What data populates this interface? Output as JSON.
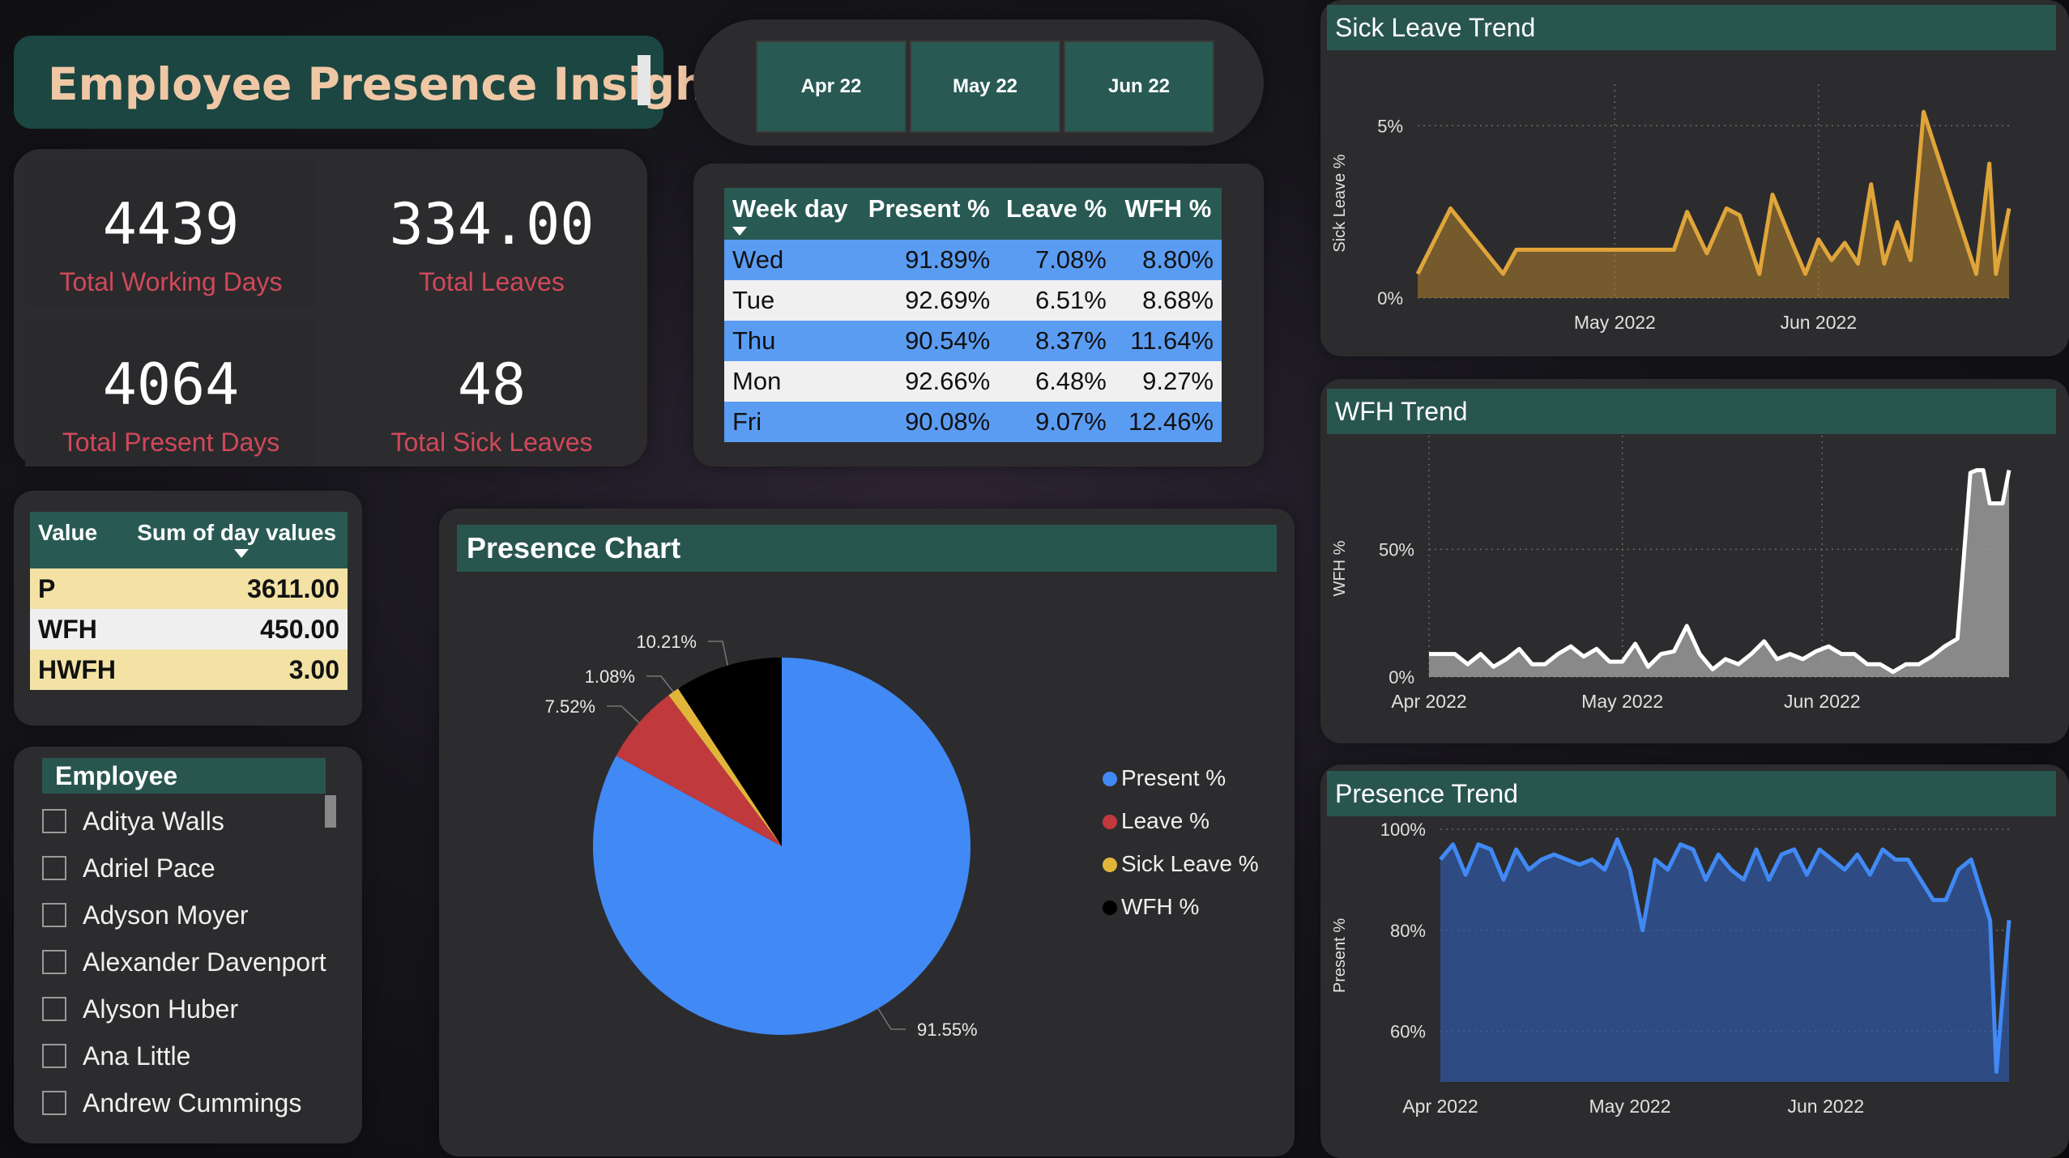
{
  "title": "Employee Presence Insights",
  "dates": [
    "Apr 22",
    "May 22",
    "Jun 22"
  ],
  "kpis": [
    {
      "value": "4439",
      "label": "Total Working Days"
    },
    {
      "value": "334.00",
      "label": "Total Leaves"
    },
    {
      "value": "4064",
      "label": "Total Present Days"
    },
    {
      "value": "48",
      "label": "Total Sick Leaves"
    }
  ],
  "weekday_table": {
    "headers": [
      "Week day",
      "Present %",
      "Leave %",
      "WFH %"
    ],
    "rows": [
      [
        "Wed",
        "91.89%",
        "7.08%",
        "8.80%"
      ],
      [
        "Tue",
        "92.69%",
        "6.51%",
        "8.68%"
      ],
      [
        "Thu",
        "90.54%",
        "8.37%",
        "11.64%"
      ],
      [
        "Mon",
        "92.66%",
        "6.48%",
        "9.27%"
      ],
      [
        "Fri",
        "90.08%",
        "9.07%",
        "12.46%"
      ]
    ]
  },
  "value_table": {
    "headers": [
      "Value",
      "Sum of day values"
    ],
    "rows": [
      [
        "P",
        "3611.00"
      ],
      [
        "WFH",
        "450.00"
      ],
      [
        "HWFH",
        "3.00"
      ]
    ]
  },
  "employee_slicer": {
    "header": "Employee",
    "items": [
      "Aditya Walls",
      "Adriel Pace",
      "Adyson Moyer",
      "Alexander Davenport",
      "Alyson Huber",
      "Ana Little",
      "Andrew Cummings"
    ]
  },
  "colors": {
    "header": "#28564f",
    "present": "#4189f5",
    "leave": "#c0393d",
    "sick": "#e0b53a",
    "wfh": "#000000",
    "kpi_label": "#d1485a",
    "title_text": "#f0c7a5"
  },
  "chart_data": [
    {
      "type": "pie",
      "title": "Presence Chart",
      "categories": [
        "Present %",
        "Leave %",
        "Sick Leave %",
        "WFH %"
      ],
      "values": [
        91.55,
        7.52,
        1.08,
        10.21
      ],
      "labels": [
        "91.55%",
        "7.52%",
        "1.08%",
        "10.21%"
      ],
      "legend": "right"
    },
    {
      "type": "area",
      "title": "Sick Leave Trend",
      "ylabel": "Sick Leave %",
      "y_ticks": [
        "0%",
        "5%"
      ],
      "x_ticks": [
        "May 2022",
        "Jun 2022"
      ],
      "x_range": [
        "2022-04-01",
        "2022-06-30"
      ],
      "ylim": [
        0,
        5.5
      ],
      "x": [
        "2022-04-01",
        "2022-04-06",
        "2022-04-14",
        "2022-04-16",
        "2022-04-23",
        "2022-04-27",
        "2022-05-02",
        "2022-05-05",
        "2022-05-07",
        "2022-05-08",
        "2022-05-10",
        "2022-05-12",
        "2022-05-15",
        "2022-05-18",
        "2022-05-20",
        "2022-05-23",
        "2022-05-25",
        "2022-05-28",
        "2022-05-30",
        "2022-06-01",
        "2022-06-03",
        "2022-06-05",
        "2022-06-07",
        "2022-06-09",
        "2022-06-11",
        "2022-06-13",
        "2022-06-15",
        "2022-06-17",
        "2022-06-25",
        "2022-06-27",
        "2022-06-28",
        "2022-06-30"
      ],
      "values": [
        0.7,
        2.6,
        0.7,
        1.4,
        1.4,
        1.4,
        1.4,
        1.4,
        1.4,
        1.4,
        1.4,
        2.5,
        1.3,
        2.6,
        2.4,
        0.7,
        3.0,
        1.6,
        0.7,
        1.7,
        1.1,
        1.6,
        1.0,
        3.3,
        1.0,
        2.2,
        1.1,
        5.4,
        0.7,
        3.9,
        0.7,
        2.6
      ],
      "color": "#e0a53a"
    },
    {
      "type": "area",
      "title": "WFH Trend",
      "ylabel": "WFH %",
      "y_ticks": [
        "0%",
        "50%"
      ],
      "x_ticks": [
        "Apr 2022",
        "May 2022",
        "Jun 2022"
      ],
      "x_range": [
        "2022-04-01",
        "2022-06-30"
      ],
      "ylim": [
        0,
        85
      ],
      "x": [
        "2022-04-01",
        "2022-04-03",
        "2022-04-05",
        "2022-04-07",
        "2022-04-09",
        "2022-04-11",
        "2022-04-13",
        "2022-04-15",
        "2022-04-17",
        "2022-04-19",
        "2022-04-21",
        "2022-04-23",
        "2022-04-25",
        "2022-04-27",
        "2022-04-29",
        "2022-05-01",
        "2022-05-03",
        "2022-05-05",
        "2022-05-07",
        "2022-05-09",
        "2022-05-11",
        "2022-05-13",
        "2022-05-15",
        "2022-05-17",
        "2022-05-19",
        "2022-05-21",
        "2022-05-23",
        "2022-05-25",
        "2022-05-27",
        "2022-05-29",
        "2022-05-31",
        "2022-06-02",
        "2022-06-04",
        "2022-06-06",
        "2022-06-08",
        "2022-06-10",
        "2022-06-12",
        "2022-06-14",
        "2022-06-16",
        "2022-06-18",
        "2022-06-20",
        "2022-06-22",
        "2022-06-24",
        "2022-06-25",
        "2022-06-26",
        "2022-06-27",
        "2022-06-29",
        "2022-06-30"
      ],
      "values": [
        9,
        9,
        9,
        5,
        9,
        4,
        7,
        11,
        5,
        5,
        9,
        12,
        8,
        11,
        6,
        6,
        13,
        4,
        9,
        10,
        20,
        9,
        3,
        7,
        5,
        9,
        14,
        7,
        9,
        7,
        10,
        12,
        9,
        9,
        5,
        5,
        2,
        5,
        5,
        8,
        12,
        15,
        80,
        81,
        81,
        68,
        68,
        81
      ],
      "color": "#ffffff"
    },
    {
      "type": "area",
      "title": "Presence Trend",
      "ylabel": "Present %",
      "y_ticks": [
        "60%",
        "80%",
        "100%"
      ],
      "x_ticks": [
        "Apr 2022",
        "May 2022",
        "Jun 2022"
      ],
      "x_range": [
        "2022-04-01",
        "2022-06-30"
      ],
      "ylim": [
        50,
        100
      ],
      "x": [
        "2022-04-01",
        "2022-04-03",
        "2022-04-05",
        "2022-04-07",
        "2022-04-09",
        "2022-04-11",
        "2022-04-13",
        "2022-04-15",
        "2022-04-17",
        "2022-04-19",
        "2022-04-21",
        "2022-04-23",
        "2022-04-25",
        "2022-04-27",
        "2022-04-29",
        "2022-05-01",
        "2022-05-03",
        "2022-05-05",
        "2022-05-07",
        "2022-05-09",
        "2022-05-11",
        "2022-05-13",
        "2022-05-15",
        "2022-05-17",
        "2022-05-19",
        "2022-05-21",
        "2022-05-23",
        "2022-05-25",
        "2022-05-27",
        "2022-05-29",
        "2022-05-31",
        "2022-06-02",
        "2022-06-04",
        "2022-06-06",
        "2022-06-08",
        "2022-06-10",
        "2022-06-12",
        "2022-06-14",
        "2022-06-16",
        "2022-06-18",
        "2022-06-20",
        "2022-06-22",
        "2022-06-24",
        "2022-06-26",
        "2022-06-27",
        "2022-06-28",
        "2022-06-30"
      ],
      "values": [
        94,
        97,
        91,
        97,
        96,
        90,
        96,
        92,
        94,
        95,
        94,
        93,
        94,
        92,
        98,
        92,
        80,
        94,
        92,
        97,
        96,
        90,
        95,
        92,
        90,
        96,
        90,
        95,
        96,
        91,
        96,
        94,
        92,
        95,
        91,
        96,
        94,
        94,
        90,
        86,
        86,
        92,
        94,
        86,
        82,
        52,
        82
      ],
      "color": "#4189f5"
    }
  ]
}
